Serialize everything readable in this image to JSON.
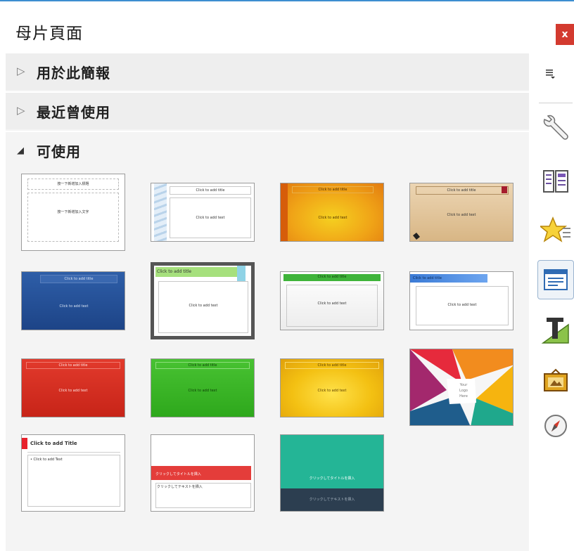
{
  "panel": {
    "title": "母片頁面",
    "close_label": "x"
  },
  "sections": [
    {
      "label": "用於此簡報",
      "arrow": "▷"
    },
    {
      "label": "最近曾使用",
      "arrow": "▷"
    },
    {
      "label": "可使用",
      "arrow": "◢"
    }
  ],
  "thumbnails": {
    "t1": {
      "title": "按一下新增加入標題",
      "body": "按一下新增加入文字"
    },
    "t2": {
      "title": "Click to add title",
      "body": "Click to add text"
    },
    "t3": {
      "title": "Click to add title",
      "body": "Click to add text"
    },
    "t4": {
      "title": "Click to add title",
      "body": "Click to add text"
    },
    "t5": {
      "title": "Click to add title",
      "body": "Click to add text"
    },
    "t6": {
      "title": "Click to add title",
      "body": "Click to add text"
    },
    "t7": {
      "title": "Click to add title",
      "body": "Click to add text"
    },
    "t8": {
      "title": "Click to add title",
      "body": "Click to add text"
    },
    "t9": {
      "title": "Click to add title",
      "body": "Click to add text"
    },
    "t10": {
      "title": "Click to add title",
      "body": "Click to add text"
    },
    "t11": {
      "title": "Click to add title",
      "body": "Click to add text"
    },
    "t12": {
      "logo_line1": "Your",
      "logo_line2": "Logo",
      "logo_line3": "Here"
    },
    "t13": {
      "title": "Click to add Title",
      "body": "• Click to add Text"
    },
    "t14": {
      "title": "クリックしてタイトルを挿入",
      "body": "クリックしてテキストを挿入"
    },
    "t15": {
      "title": "クリックしてタイトルを挿入",
      "body": "クリックしてテキストを挿入"
    }
  },
  "sidebar": {
    "menu_icon": "menu-icon",
    "items": [
      {
        "icon": "properties-wrench-icon"
      },
      {
        "icon": "slide-layouts-icon"
      },
      {
        "icon": "animation-star-icon"
      },
      {
        "icon": "master-slides-icon"
      },
      {
        "icon": "styles-icon"
      },
      {
        "icon": "gallery-icon"
      },
      {
        "icon": "navigator-compass-icon"
      }
    ]
  }
}
